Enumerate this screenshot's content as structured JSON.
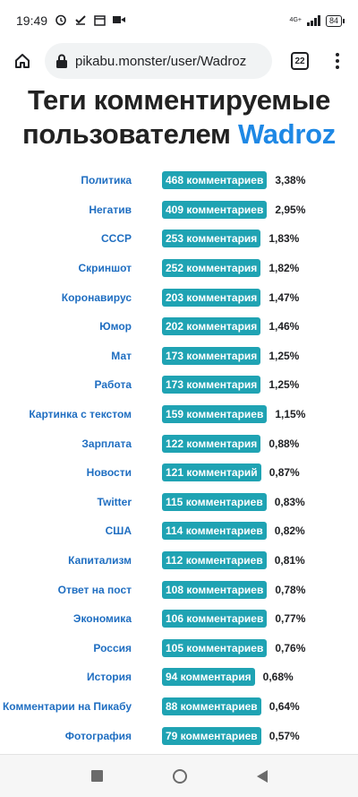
{
  "status_bar": {
    "time": "19:49",
    "network": "4G+",
    "battery": "84"
  },
  "browser": {
    "url": "pikabu.monster/user/Wadroz",
    "tab_count": "22"
  },
  "page": {
    "title_prefix": "Теги комментируемые пользователем",
    "username": "Wadroz"
  },
  "tags": [
    {
      "name": "Политика",
      "count": "468 комментариев",
      "percent": "3,38%"
    },
    {
      "name": "Негатив",
      "count": "409 комментариев",
      "percent": "2,95%"
    },
    {
      "name": "СССР",
      "count": "253 комментария",
      "percent": "1,83%"
    },
    {
      "name": "Скриншот",
      "count": "252 комментария",
      "percent": "1,82%"
    },
    {
      "name": "Коронавирус",
      "count": "203 комментария",
      "percent": "1,47%"
    },
    {
      "name": "Юмор",
      "count": "202 комментария",
      "percent": "1,46%"
    },
    {
      "name": "Мат",
      "count": "173 комментария",
      "percent": "1,25%"
    },
    {
      "name": "Работа",
      "count": "173 комментария",
      "percent": "1,25%"
    },
    {
      "name": "Картинка с текстом",
      "count": "159 комментариев",
      "percent": "1,15%"
    },
    {
      "name": "Зарплата",
      "count": "122 комментария",
      "percent": "0,88%"
    },
    {
      "name": "Новости",
      "count": "121 комментарий",
      "percent": "0,87%"
    },
    {
      "name": "Twitter",
      "count": "115 комментариев",
      "percent": "0,83%"
    },
    {
      "name": "США",
      "count": "114 комментариев",
      "percent": "0,82%"
    },
    {
      "name": "Капитализм",
      "count": "112 комментариев",
      "percent": "0,81%"
    },
    {
      "name": "Ответ на пост",
      "count": "108 комментариев",
      "percent": "0,78%"
    },
    {
      "name": "Экономика",
      "count": "106 комментариев",
      "percent": "0,77%"
    },
    {
      "name": "Россия",
      "count": "105 комментариев",
      "percent": "0,76%"
    },
    {
      "name": "История",
      "count": "94 комментария",
      "percent": "0,68%"
    },
    {
      "name": "Комментарии на Пикабу",
      "count": "88 комментариев",
      "percent": "0,64%"
    },
    {
      "name": "Фотография",
      "count": "79 комментариев",
      "percent": "0,57%"
    }
  ],
  "icons": {
    "home": "home-icon",
    "lock": "lock-icon",
    "menu": "more-vert-icon",
    "alarm": "alarm-icon",
    "check": "check-icon",
    "video": "video-icon"
  },
  "colors": {
    "tag_link": "#1f6ec1",
    "badge": "#1fa3b3",
    "username": "#1e88e5"
  }
}
